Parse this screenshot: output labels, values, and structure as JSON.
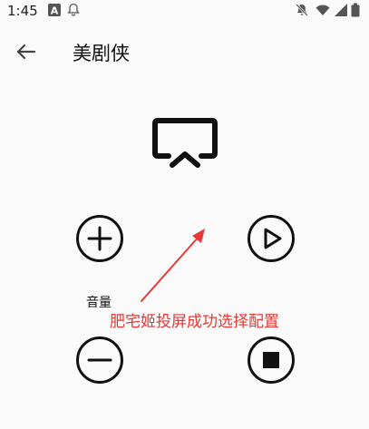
{
  "status_bar": {
    "time": "1:45",
    "left_icons": [
      "a-badge-icon",
      "bell-off-icon"
    ],
    "right_icons": [
      "notifications-off-icon",
      "wifi-icon",
      "signal-icon",
      "battery-icon"
    ]
  },
  "app_bar": {
    "title": "美剧侠",
    "back_icon": "arrow-back-icon"
  },
  "player": {
    "cast_icon": "cast-icon",
    "volume_label": "音量",
    "controls": [
      "volume-up",
      "play",
      "volume-down",
      "stop"
    ]
  },
  "annotation": {
    "text": "肥宅姬投屏成功选择配置",
    "color": "#e53935"
  }
}
